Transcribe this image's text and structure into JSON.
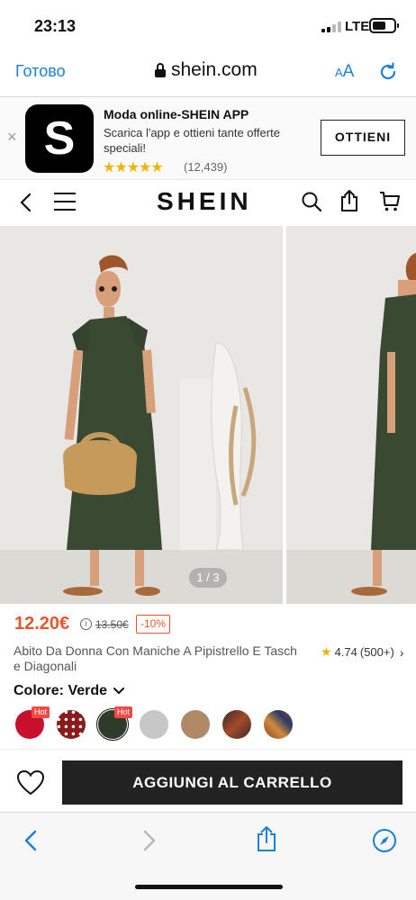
{
  "status_bar": {
    "time": "23:13",
    "network": "LTE"
  },
  "browser": {
    "done_label": "Готово",
    "url": "shein.com",
    "text_size_label_small": "A",
    "text_size_label_large": "A"
  },
  "app_banner": {
    "close_glyph": "×",
    "app_icon_letter": "S",
    "title": "Moda online-SHEIN APP",
    "subtitle": "Scarica l'app e ottieni tante offerte speciali!",
    "stars": "★★★★★",
    "rating_count": "(12,439)",
    "get_label": "OTTIENI"
  },
  "header": {
    "logo": "SHEIN"
  },
  "gallery": {
    "counter": "1 / 3"
  },
  "product": {
    "price": "12.20€",
    "info_glyph": "i",
    "old_price": "13.50€",
    "discount": "-10%",
    "title": "Abito Da Donna Con Maniche A Pipistrello E Tasch e Diagonali",
    "rating": "4.74",
    "review_count": "(500+)",
    "rating_star": "★",
    "rating_chevron": "›",
    "color_label": "Colore: Verde",
    "hot_label": "Hot",
    "swatch_colors": [
      "#c8102e",
      "#8b1a1a",
      "#2f3b2a",
      "#c7c7c7",
      "#b08a66",
      "#3b2a2a",
      "#8a4a2a"
    ]
  },
  "cart": {
    "add_label": "AGGIUNGI AL CARRELLO"
  },
  "colors": {
    "accent": "#1a7fe0",
    "price": "#e4572e",
    "dress": "#3a4a32",
    "button": "#222222"
  }
}
